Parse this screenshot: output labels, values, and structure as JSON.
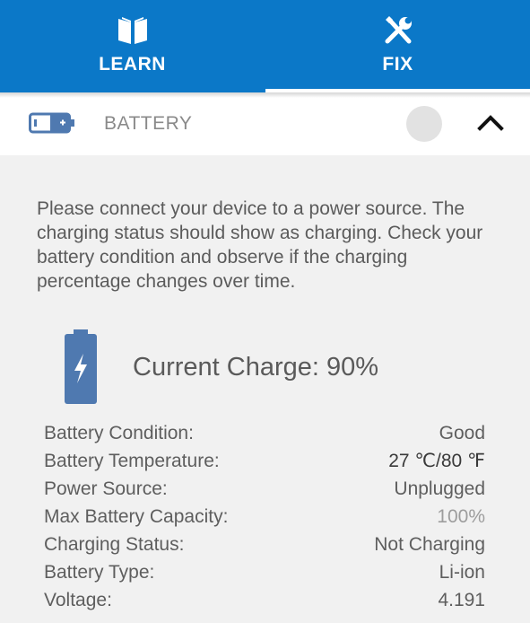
{
  "tabs": [
    {
      "label": "LEARN",
      "icon": "book-icon",
      "active": false
    },
    {
      "label": "FIX",
      "icon": "tools-icon",
      "active": true
    }
  ],
  "section": {
    "title": "BATTERY",
    "icon": "battery-icon",
    "toggle_icon": "chevron-up-icon"
  },
  "instructions": "Please connect your device to a power source. The charging status should show as charging. Check your battery condition and observe if the charging percentage changes over time.",
  "charge": {
    "label": "Current Charge: 90%",
    "icon": "battery-charging-icon"
  },
  "details": [
    {
      "label": "Battery Condition:",
      "value": "Good"
    },
    {
      "label": "Battery Temperature:",
      "value": "27 ℃/80 ℉"
    },
    {
      "label": "Power Source:",
      "value": "Unplugged"
    },
    {
      "label": "Max Battery Capacity:",
      "value": "100%"
    },
    {
      "label": "Charging Status:",
      "value": "Not Charging"
    },
    {
      "label": "Battery Type:",
      "value": "Li-ion"
    },
    {
      "label": "Voltage:",
      "value": "4.191"
    }
  ],
  "colors": {
    "header_blue": "#0b78c8",
    "battery_blue": "#4f79b0",
    "text_gray": "#5e5e5e"
  }
}
